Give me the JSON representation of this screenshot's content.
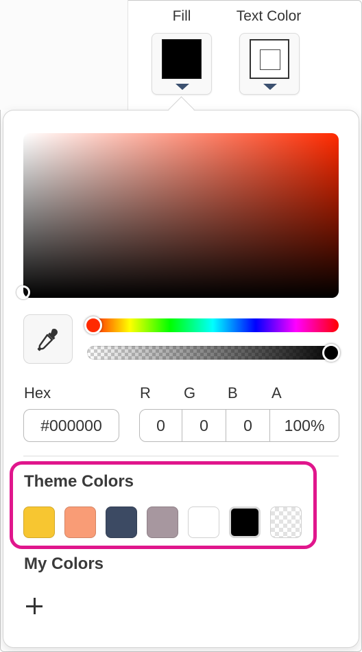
{
  "toolbar": {
    "fill_label": "Fill",
    "text_color_label": "Text Color"
  },
  "picker": {
    "hue_level": 0.0,
    "alpha_level": 1.0,
    "labels": {
      "hex": "Hex",
      "r": "R",
      "g": "G",
      "b": "B",
      "a": "A"
    },
    "values": {
      "hex": "#000000",
      "r": "0",
      "g": "0",
      "b": "0",
      "a": "100%"
    }
  },
  "theme_colors": {
    "title": "Theme Colors",
    "swatches": [
      {
        "name": "yellow",
        "color": "#f7c631"
      },
      {
        "name": "salmon",
        "color": "#f99c76"
      },
      {
        "name": "navy",
        "color": "#3c4a63"
      },
      {
        "name": "mauve",
        "color": "#a7979f"
      },
      {
        "name": "white",
        "color": "#ffffff"
      },
      {
        "name": "black",
        "color": "#000000"
      },
      {
        "name": "transparent",
        "color": "transparent"
      }
    ]
  },
  "my_colors": {
    "title": "My Colors"
  },
  "colors": {
    "highlight": "#e0168c",
    "caret": "#3c5170",
    "accent": "#ff2a00"
  }
}
